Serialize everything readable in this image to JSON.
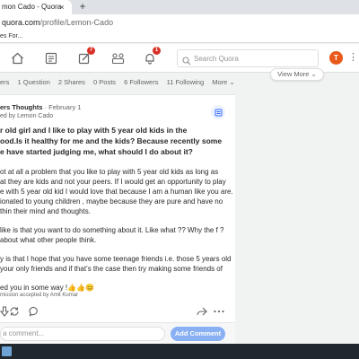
{
  "browser": {
    "tab_title": "mon Cado - Quora",
    "tab_close": "×",
    "new_tab": "+",
    "url_host": "quora.com",
    "url_path": "/profile/Lemon-Cado",
    "bookmark_label": "es For..."
  },
  "quora_header": {
    "nav": [
      {
        "name": "home-icon",
        "badge": ""
      },
      {
        "name": "answer-list-icon",
        "badge": ""
      },
      {
        "name": "edit-icon",
        "badge": "7"
      },
      {
        "name": "spaces-icon",
        "badge": ""
      },
      {
        "name": "bell-icon",
        "badge": "1"
      }
    ],
    "search_placeholder": "Search Quora",
    "avatar_initial": "T",
    "more": "⋮"
  },
  "profile_stats": {
    "items": [
      "ers",
      "1 Question",
      "2 Shares",
      "0 Posts",
      "6 Followers",
      "11 Following"
    ],
    "more_label": "More ⌄",
    "view_more": "View More ⌄"
  },
  "post": {
    "space_name": "ers Thoughts",
    "date": " · February 1",
    "shared_by": "ed by Lemon Cado",
    "question_lines": [
      "r old girl and I like to play with 5 year old kids in the",
      "ood.Is it healthy for me and the kids? Because recently some",
      "e have started judging me, what should I do about it?"
    ],
    "answer_paragraphs": [
      [
        "ot at all a problem that you like to play with 5 year old kids as long as",
        "at they are kids and not your peers. If I would get an opportunity to play",
        "e with 5 year old kid I would love that because I am a human like you are.",
        "ionated to young children , maybe because they are pure and have no",
        "thin their mind and thoughts."
      ],
      [
        "like is that you want to do something about it. Like what ?? Why the f ?",
        "about what other people think."
      ],
      [
        "y is that I hope that you have some teenage friends i.e. those 5 years old",
        "your only friends and if that’s the case then try making some friends of"
      ],
      [
        "ed you in some way !👍👍😊"
      ]
    ],
    "admission": "mission accepted by Amit Kumar",
    "comment_placeholder": "a comment...",
    "add_comment_label": "Add Comment"
  },
  "colors": {
    "accent": "#2e69ff",
    "add_comment_bg": "#8ab0f4",
    "badge": "#d93025",
    "avatar": "#e8591a"
  }
}
